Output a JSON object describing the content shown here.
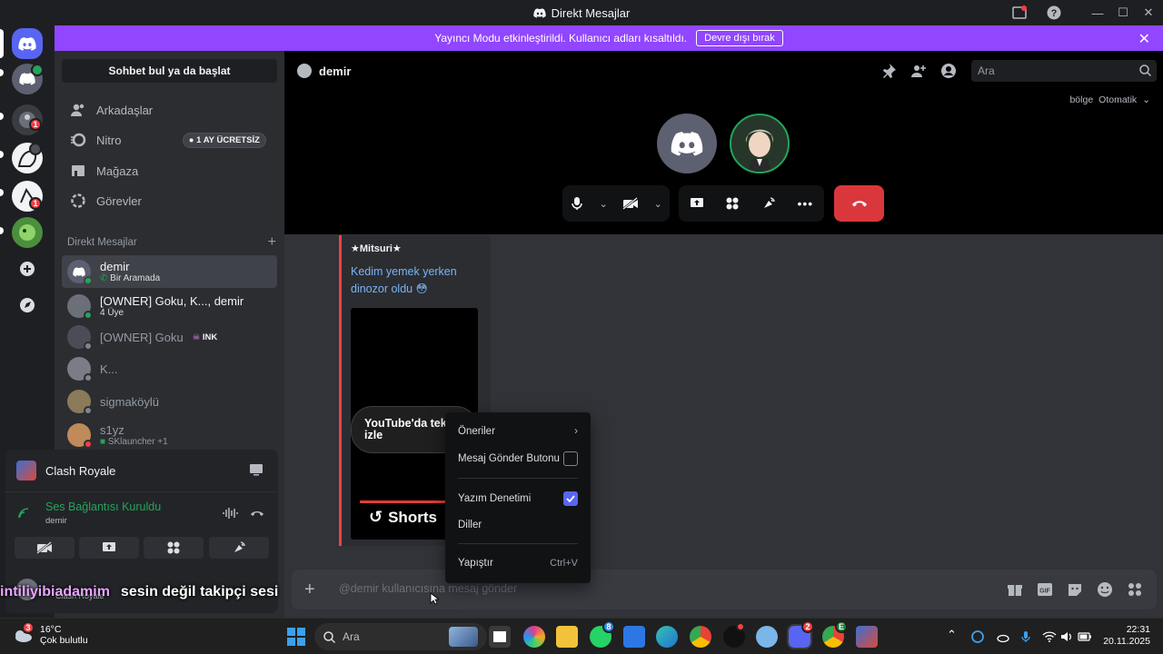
{
  "window": {
    "title": "Direkt Mesajlar"
  },
  "banner": {
    "text": "Yayıncı Modu etkinleştirildi. Kullanıcı adları kısaltıldı.",
    "button": "Devre dışı bırak"
  },
  "rail": {
    "badges": [
      "1",
      "1"
    ]
  },
  "sidebar": {
    "find": "Sohbet bul ya da başlat",
    "nav": [
      {
        "label": "Arkadaşlar",
        "icon": "friends-icon"
      },
      {
        "label": "Nitro",
        "icon": "nitro-icon",
        "badge": "1 AY ÜCRETSİZ"
      },
      {
        "label": "Mağaza",
        "icon": "shop-icon"
      },
      {
        "label": "Görevler",
        "icon": "quests-icon"
      }
    ],
    "dm_header": "Direkt Mesajlar",
    "dms": [
      {
        "name": "demir",
        "sub": "Bir Aramada"
      },
      {
        "name": "[OWNER] Goku, K..., demir",
        "sub": "4 Üye"
      },
      {
        "name": "[OWNER] Goku",
        "tag": "INK"
      },
      {
        "name": "K..."
      },
      {
        "name": "sigmaköylü"
      },
      {
        "name": "s1yz",
        "sub": "SKlauncher +1"
      }
    ]
  },
  "activity": {
    "game": "Clash Royale",
    "voice_status": "Ses Bağlantısı Kuruldu",
    "voice_channel": "demir",
    "user_tag": "Clash Royale"
  },
  "call": {
    "channel": "demir",
    "search_placeholder": "Ara",
    "region_label": "bölge",
    "region_value": "Otomatik"
  },
  "message": {
    "author": "★Mitsuri★",
    "link_text": "Kedim yemek yerken dinozor oldu",
    "video_title_line1": "YouTube'da tek",
    "video_title_line2": "izle",
    "shorts_label": "Shorts"
  },
  "context_menu": {
    "items": [
      {
        "label": "Öneriler",
        "type": "submenu"
      },
      {
        "label": "Mesaj Gönder Butonu",
        "type": "checkbox",
        "checked": false
      },
      {
        "label": "Yazım Denetimi",
        "type": "checkbox",
        "checked": true
      },
      {
        "label": "Diller",
        "type": "plain"
      },
      {
        "label": "Yapıştır",
        "type": "shortcut",
        "shortcut": "Ctrl+V"
      }
    ]
  },
  "composer": {
    "placeholder": "@demir kullanıcısına mesaj gönder"
  },
  "caption": {
    "part1": "intiliyibiadamim",
    "part2": "sesin değil takipçi sesi"
  },
  "taskbar": {
    "weather_temp": "16°C",
    "weather_desc": "Çok bulutlu",
    "weather_badge": "3",
    "search": "Ara",
    "time": "22:31",
    "date": "20.11.2025",
    "badges": {
      "whatsapp": "8",
      "discord": "2",
      "chrome": "E"
    }
  },
  "colors": {
    "blurple": "#5865f2",
    "streamer": "#9146ff",
    "danger": "#da373c",
    "online": "#23a55a"
  }
}
